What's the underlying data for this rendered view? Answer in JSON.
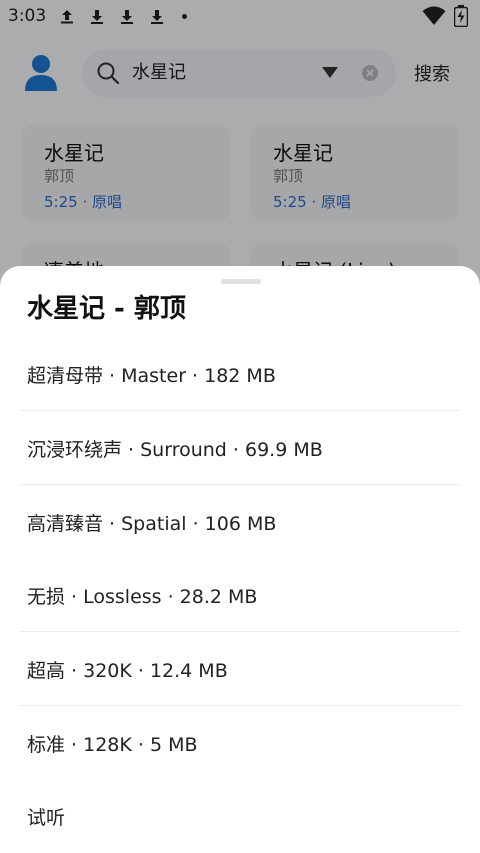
{
  "status_bar": {
    "time": "3:03"
  },
  "search": {
    "query": "水星记",
    "button_label": "搜索"
  },
  "cards": [
    {
      "title": "水星记",
      "artist": "郭顶",
      "duration": "5:25",
      "tag": "原唱"
    },
    {
      "title": "水星记",
      "artist": "郭顶",
      "duration": "5:25",
      "tag": "原唱"
    },
    {
      "title": "凄美地",
      "artist": "",
      "duration": "",
      "tag": ""
    },
    {
      "title": "水星记 (Live)",
      "artist": "",
      "duration": "",
      "tag": ""
    }
  ],
  "sheet": {
    "title": "水星记 - 郭顶",
    "options": [
      "超清母带 · Master · 182 MB",
      "沉浸环绕声 · Surround · 69.9 MB",
      "高清臻音 · Spatial · 106 MB",
      "无损 · Lossless · 28.2 MB",
      "超高 · 320K · 12.4 MB",
      "标准 · 128K · 5 MB",
      "试听"
    ]
  },
  "colors": {
    "accent": "#2f68c8",
    "avatar": "#1e78d2",
    "overlay": "#000000",
    "sheet_bg": "#ffffff"
  },
  "icons": {
    "status": [
      "upload-icon",
      "download-icon",
      "download-icon",
      "download-icon",
      "wifi-icon",
      "battery-charging-icon"
    ],
    "search": "search-icon",
    "dropdown": "caret-down-icon",
    "clear": "clear-icon",
    "avatar": "user-avatar-icon"
  }
}
